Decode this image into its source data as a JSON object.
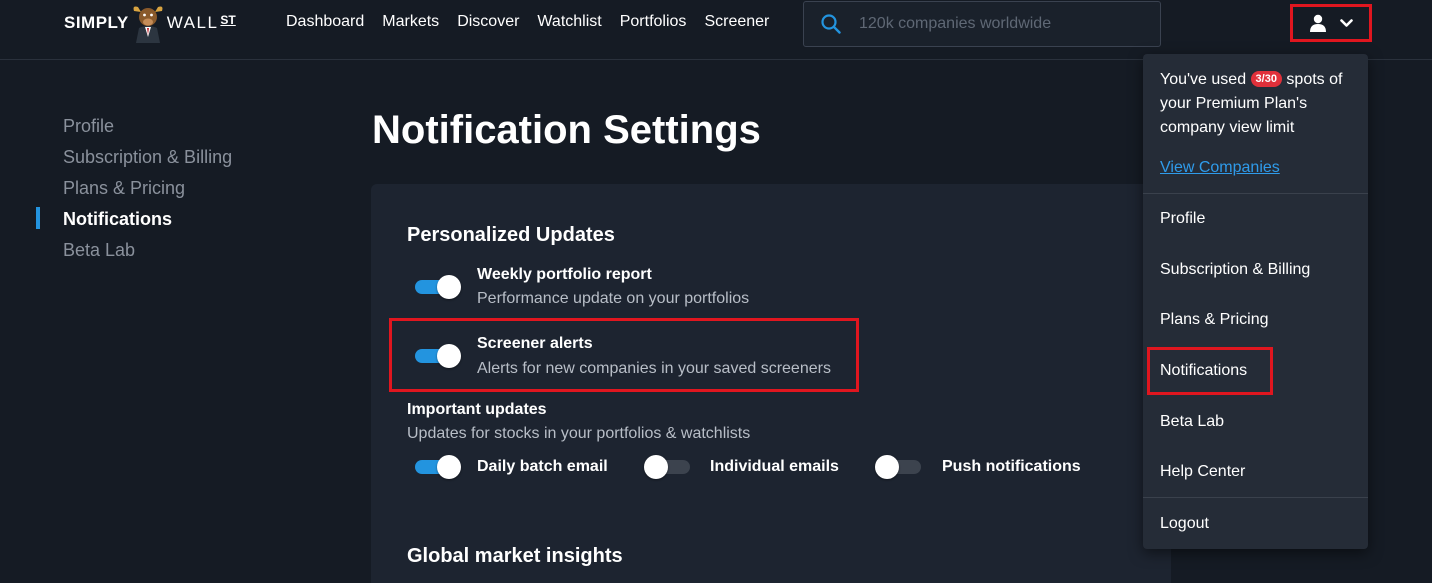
{
  "header": {
    "logo": {
      "part1": "SIMPLY",
      "part2": "WALL",
      "part3": "ST"
    },
    "nav": [
      "Dashboard",
      "Markets",
      "Discover",
      "Watchlist",
      "Portfolios",
      "Screener"
    ],
    "search_placeholder": "120k companies worldwide",
    "user_icon": "user-icon",
    "chevron_icon": "chevron-down-icon"
  },
  "sidebar": {
    "items": [
      {
        "label": "Profile",
        "active": false
      },
      {
        "label": "Subscription & Billing",
        "active": false
      },
      {
        "label": "Plans & Pricing",
        "active": false
      },
      {
        "label": "Notifications",
        "active": true
      },
      {
        "label": "Beta Lab",
        "active": false
      }
    ]
  },
  "main": {
    "title": "Notification Settings",
    "personalized": {
      "heading": "Personalized Updates",
      "weekly": {
        "title": "Weekly portfolio report",
        "desc": "Performance update on your portfolios",
        "on": true
      },
      "screener": {
        "title": "Screener alerts",
        "desc": "Alerts for new companies in your saved screeners",
        "on": true
      },
      "important": {
        "title": "Important updates",
        "desc": "Updates for stocks in your portfolios & watchlists",
        "options": [
          {
            "label": "Daily batch email",
            "on": true
          },
          {
            "label": "Individual emails",
            "on": false
          },
          {
            "label": "Push notifications",
            "on": false
          }
        ]
      }
    },
    "global_heading": "Global market insights"
  },
  "dropdown": {
    "usage_pre": "You've used",
    "usage_badge": "3/30",
    "usage_post": "spots of your Premium Plan's company view limit",
    "view_link": "View Companies",
    "items": [
      "Profile",
      "Subscription & Billing",
      "Plans & Pricing",
      "Notifications",
      "Beta Lab",
      "Help Center"
    ],
    "logout": "Logout"
  },
  "colors": {
    "accent": "#2394df",
    "highlight": "#e0161f",
    "badge": "#e0303a"
  }
}
